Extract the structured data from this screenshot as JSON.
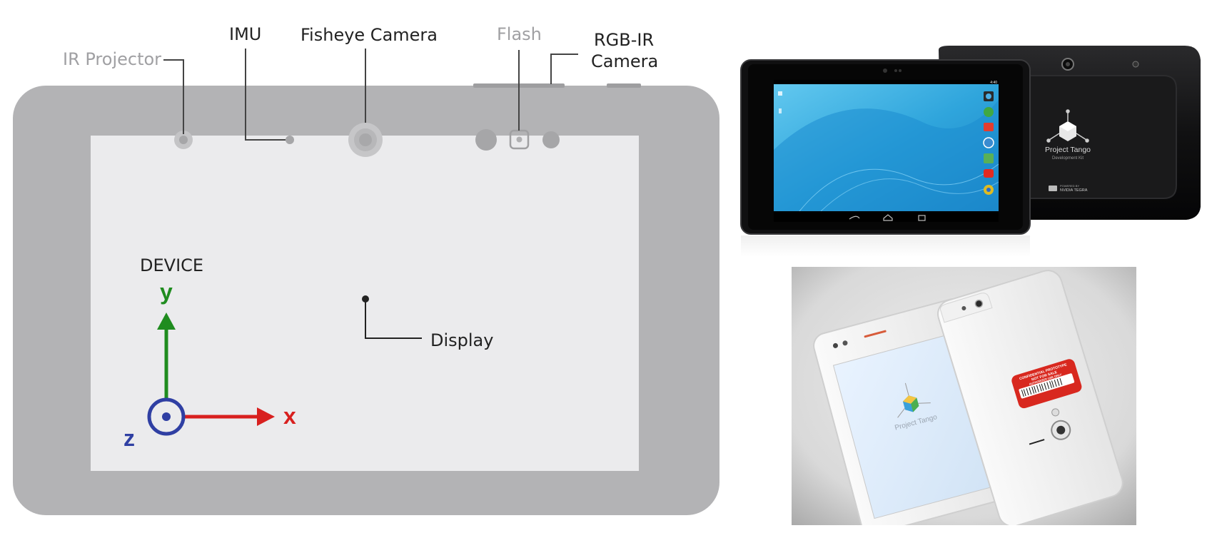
{
  "diagram": {
    "labels": {
      "ir_projector": "IR Projector",
      "imu": "IMU",
      "fisheye_camera": "Fisheye Camera",
      "flash": "Flash",
      "rgb_ir_line1": "RGB-IR",
      "rgb_ir_line2": "Camera",
      "device": "DEVICE",
      "display": "Display"
    },
    "axes": {
      "y": "y",
      "x": "x",
      "z": "z"
    },
    "colors": {
      "device_body": "#b3b3b5",
      "screen": "#ebebed",
      "muted_label": "#a0a0a3",
      "y_axis": "#1f8c1f",
      "x_axis": "#d8201f",
      "z_axis": "#2f3fa3"
    }
  },
  "tablet_photo": {
    "front_brand": "Project Tango",
    "front_subtitle": "Development Kit",
    "powered_by_line1": "POWERED BY",
    "powered_by_line2": "NVIDIA TEGRA",
    "status_time": "4:40"
  },
  "phone_photo": {
    "screen_logo_text": "Project Tango",
    "sticker_line1": "CONFIDENTIAL PROTOTYPE",
    "sticker_line2": "NOT FOR SALE",
    "sticker_line3": "AUTHORIZED USE ONLY"
  }
}
